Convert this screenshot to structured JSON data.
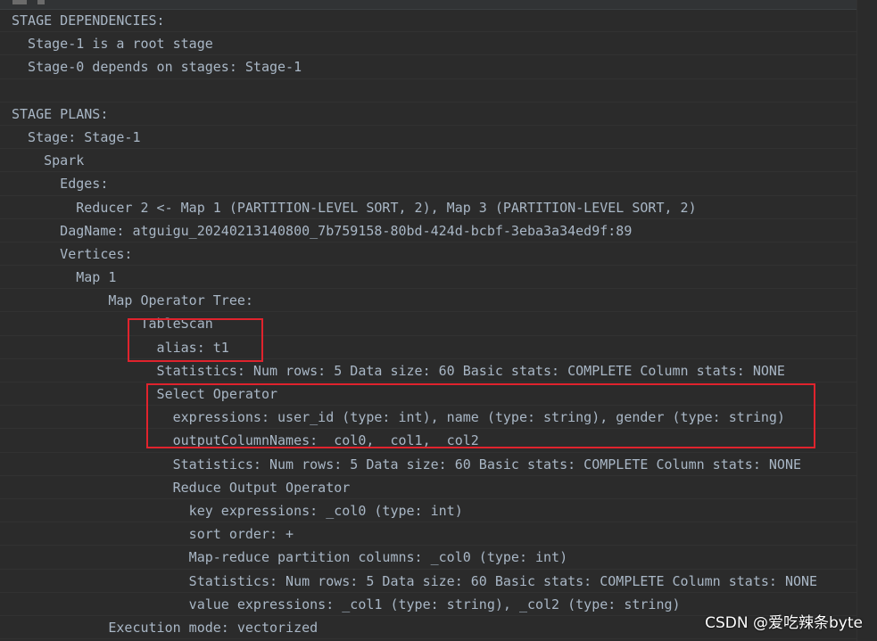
{
  "lines": [
    "STAGE DEPENDENCIES:",
    "  Stage-1 is a root stage",
    "  Stage-0 depends on stages: Stage-1",
    "",
    "STAGE PLANS:",
    "  Stage: Stage-1",
    "    Spark",
    "      Edges:",
    "        Reducer 2 <- Map 1 (PARTITION-LEVEL SORT, 2), Map 3 (PARTITION-LEVEL SORT, 2)",
    "      DagName: atguigu_20240213140800_7b759158-80bd-424d-bcbf-3eba3a34ed9f:89",
    "      Vertices:",
    "        Map 1",
    "            Map Operator Tree:",
    "                TableScan",
    "                  alias: t1",
    "                  Statistics: Num rows: 5 Data size: 60 Basic stats: COMPLETE Column stats: NONE",
    "                  Select Operator",
    "                    expressions: user_id (type: int), name (type: string), gender (type: string)",
    "                    outputColumnNames: _col0, _col1, _col2",
    "                    Statistics: Num rows: 5 Data size: 60 Basic stats: COMPLETE Column stats: NONE",
    "                    Reduce Output Operator",
    "                      key expressions: _col0 (type: int)",
    "                      sort order: +",
    "                      Map-reduce partition columns: _col0 (type: int)",
    "                      Statistics: Num rows: 5 Data size: 60 Basic stats: COMPLETE Column stats: NONE",
    "                      value expressions: _col1 (type: string), _col2 (type: string)",
    "            Execution mode: vectorized"
  ],
  "watermark": "CSDN @爱吃辣条byte",
  "colors": {
    "background": "#2b2b2b",
    "text": "#a9b7c6",
    "highlight_box": "#e0232d"
  }
}
